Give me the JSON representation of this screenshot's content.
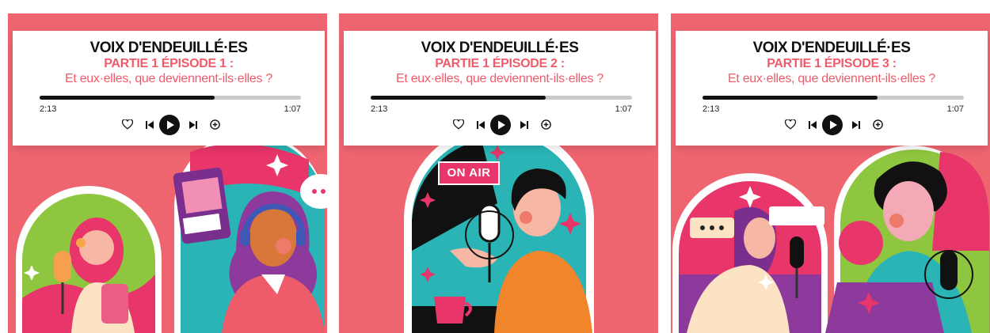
{
  "series_title": "VOIX D'ENDEUILLÉ·ES",
  "subtitle": "Et eux·elles, que deviennent-ils·elles ?",
  "colors": {
    "background": "#ee6570",
    "accent": "#ee5c6b",
    "progress": "#111111",
    "track": "#c9c9c9"
  },
  "episodes": [
    {
      "part_label": "PARTIE 1 ÉPISODE 1 :",
      "elapsed": "2:13",
      "remaining": "1:07",
      "progress_fraction": 0.67
    },
    {
      "part_label": "PARTIE 1 ÉPISODE 2 :",
      "elapsed": "2:13",
      "remaining": "1:07",
      "progress_fraction": 0.67
    },
    {
      "part_label": "PARTIE 1 ÉPISODE 3 :",
      "elapsed": "2:13",
      "remaining": "1:07",
      "progress_fraction": 0.67
    }
  ],
  "illustrations": {
    "on_air_sign": "ON AIR"
  },
  "icons": [
    "heart-icon",
    "skip-previous-icon",
    "play-icon",
    "skip-next-icon",
    "add-circle-icon"
  ]
}
